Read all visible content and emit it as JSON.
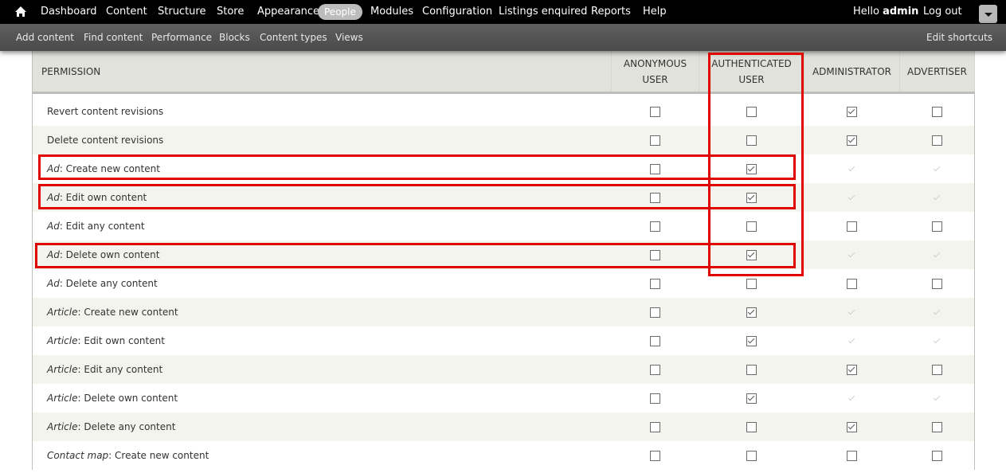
{
  "toolbar": {
    "menu": [
      "Dashboard",
      "Content",
      "Structure",
      "Store",
      "Appearance",
      "People",
      "Modules",
      "Configuration",
      "Listings enquired",
      "Reports",
      "Help"
    ],
    "active_index": 5,
    "hello_prefix": "Hello ",
    "username": "admin",
    "logout": "Log out"
  },
  "shortcuts": {
    "items": [
      "Add content",
      "Find content",
      "Performance",
      "Blocks",
      "Content types",
      "Views"
    ],
    "edit": "Edit shortcuts"
  },
  "table": {
    "header_permission": "PERMISSION",
    "roles": [
      {
        "line1": "ANONYMOUS",
        "line2": "USER"
      },
      {
        "line1": "AUTHENTICATED",
        "line2": "USER"
      },
      {
        "line1": "ADMINISTRATOR",
        "line2": ""
      },
      {
        "line1": "ADVERTISER",
        "line2": ""
      }
    ],
    "rows": [
      {
        "type": "",
        "label": "Revert content revisions",
        "perms": [
          "unchecked",
          "unchecked",
          "checked",
          "unchecked"
        ]
      },
      {
        "type": "",
        "label": "Delete content revisions",
        "perms": [
          "unchecked",
          "unchecked",
          "checked",
          "unchecked"
        ]
      },
      {
        "type": "Ad",
        "label": ": Create new content",
        "perms": [
          "unchecked",
          "checked",
          "disabled",
          "disabled"
        ]
      },
      {
        "type": "Ad",
        "label": ": Edit own content",
        "perms": [
          "unchecked",
          "checked",
          "disabled",
          "disabled"
        ]
      },
      {
        "type": "Ad",
        "label": ": Edit any content",
        "perms": [
          "unchecked",
          "unchecked",
          "unchecked",
          "unchecked"
        ]
      },
      {
        "type": "Ad",
        "label": ": Delete own content",
        "perms": [
          "unchecked",
          "checked",
          "disabled",
          "disabled"
        ]
      },
      {
        "type": "Ad",
        "label": ": Delete any content",
        "perms": [
          "unchecked",
          "unchecked",
          "unchecked",
          "unchecked"
        ]
      },
      {
        "type": "Article",
        "label": ": Create new content",
        "perms": [
          "unchecked",
          "checked",
          "disabled",
          "disabled"
        ]
      },
      {
        "type": "Article",
        "label": ": Edit own content",
        "perms": [
          "unchecked",
          "checked",
          "disabled",
          "disabled"
        ]
      },
      {
        "type": "Article",
        "label": ": Edit any content",
        "perms": [
          "unchecked",
          "unchecked",
          "checked",
          "unchecked"
        ]
      },
      {
        "type": "Article",
        "label": ": Delete own content",
        "perms": [
          "unchecked",
          "checked",
          "disabled",
          "disabled"
        ]
      },
      {
        "type": "Article",
        "label": ": Delete any content",
        "perms": [
          "unchecked",
          "unchecked",
          "checked",
          "unchecked"
        ]
      },
      {
        "type": "Contact map",
        "label": ": Create new content",
        "perms": [
          "unchecked",
          "unchecked",
          "unchecked",
          "unchecked"
        ]
      }
    ]
  },
  "colors": {
    "toolbar_bg": "#000000",
    "shortcuts_bg": "#555555",
    "header_bg": "#e1e2dc",
    "row_even_bg": "#f3f4ee",
    "highlight": "#e00000"
  }
}
